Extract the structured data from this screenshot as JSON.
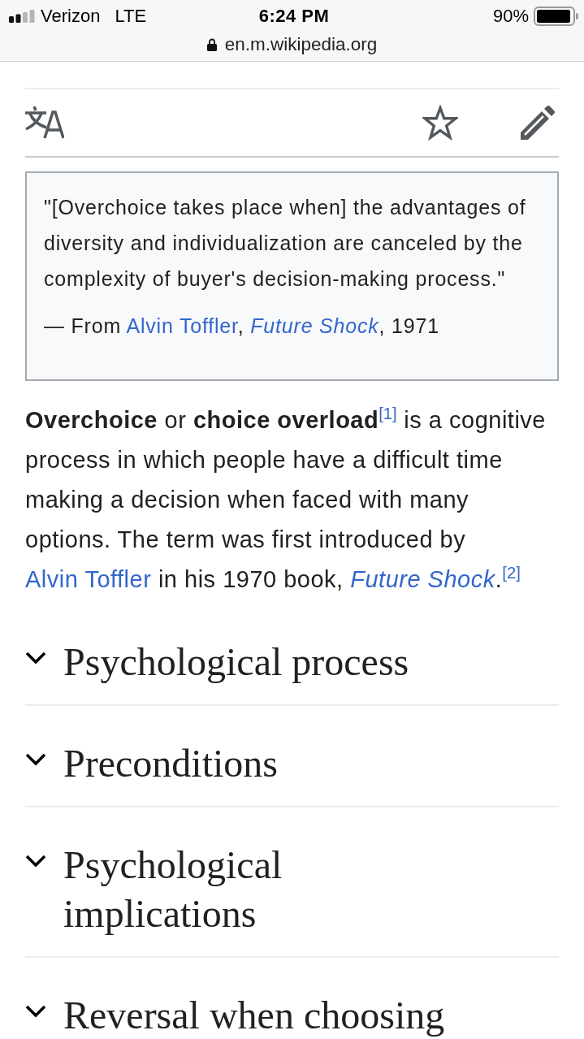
{
  "status_bar": {
    "carrier": "Verizon",
    "network": "LTE",
    "time": "6:24 PM",
    "battery": "90%"
  },
  "address_bar": {
    "url": "en.m.wikipedia.org",
    "secure": true
  },
  "quote": {
    "text": "\"[Overchoice takes place when] the advantages of diversity and individualization are canceled by the complexity of buyer's decision-making process.\"",
    "attribution": [
      {
        "kind": "text",
        "text": "— From "
      },
      {
        "kind": "link",
        "text": "Alvin Toffler"
      },
      {
        "kind": "text",
        "text": ", "
      },
      {
        "kind": "link_italic",
        "text": "Future Shock"
      },
      {
        "kind": "text",
        "text": ", 1971"
      }
    ]
  },
  "lead": [
    {
      "kind": "bold",
      "text": "Overchoice"
    },
    {
      "kind": "text",
      "text": " or "
    },
    {
      "kind": "bold",
      "text": "choice overload"
    },
    {
      "kind": "ref",
      "text": "[1]"
    },
    {
      "kind": "text",
      "text": " is a cognitive process in which people have a difficult time making a decision when faced with many options. The term was first introduced by "
    },
    {
      "kind": "link",
      "text": "Alvin Toffler"
    },
    {
      "kind": "text",
      "text": " in his 1970 book, "
    },
    {
      "kind": "link_italic",
      "text": "Future Shock"
    },
    {
      "kind": "text",
      "text": "."
    },
    {
      "kind": "ref",
      "text": "[2]"
    }
  ],
  "sections": [
    {
      "title": "Psychological process",
      "expanded": false
    },
    {
      "title": "Preconditions",
      "expanded": false
    },
    {
      "title": "Psychological implications",
      "expanded": false
    },
    {
      "title": "Reversal when choosing",
      "expanded": false
    }
  ]
}
